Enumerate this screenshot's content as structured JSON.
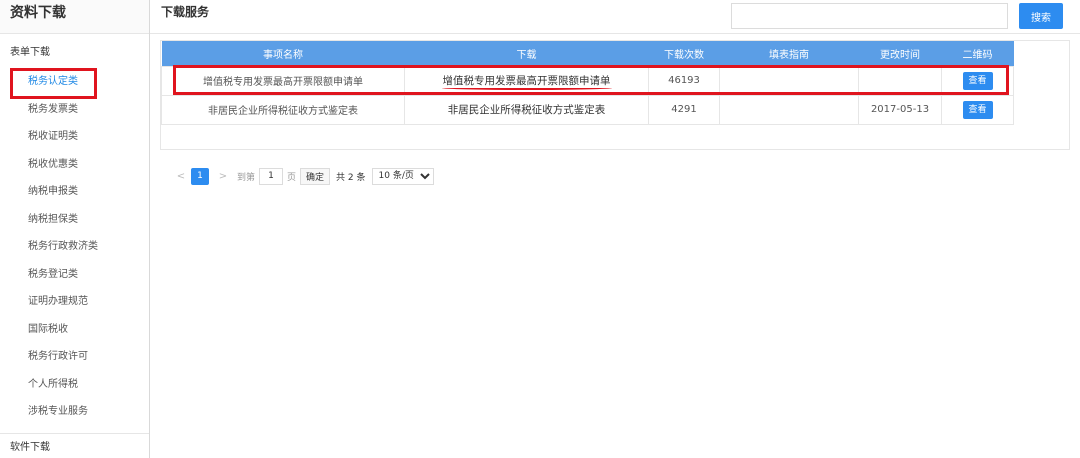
{
  "sidebar": {
    "title": "资料下载",
    "section": "表单下载",
    "items": [
      {
        "label": "税务认定类",
        "active": true
      },
      {
        "label": "税务发票类"
      },
      {
        "label": "税收证明类"
      },
      {
        "label": "税收优惠类"
      },
      {
        "label": "纳税申报类"
      },
      {
        "label": "纳税担保类"
      },
      {
        "label": "税务行政救济类"
      },
      {
        "label": "税务登记类"
      },
      {
        "label": "证明办理规范"
      },
      {
        "label": "国际税收"
      },
      {
        "label": "税务行政许可"
      },
      {
        "label": "个人所得税"
      },
      {
        "label": "涉税专业服务"
      }
    ],
    "bottom": "软件下载"
  },
  "header": {
    "title": "下载服务",
    "search_placeholder": "",
    "search_label": "搜索"
  },
  "table": {
    "columns": [
      "事项名称",
      "下载",
      "下载次数",
      "填表指南",
      "更改时间",
      "二维码"
    ],
    "rows": [
      {
        "name": "增值税专用发票最高开票限额申请单",
        "download": "增值税专用发票最高开票限额申请单",
        "count": "46193",
        "guide": "",
        "time": "",
        "qr": "查看"
      },
      {
        "name": "非居民企业所得税征收方式鉴定表",
        "download": "非居民企业所得税征收方式鉴定表",
        "count": "4291",
        "guide": "",
        "time": "2017-05-13",
        "qr": "查看"
      }
    ]
  },
  "pager": {
    "prev": "<",
    "page": "1",
    "next": ">",
    "goto_label": "到第",
    "goto_value": "1",
    "page_unit": "页",
    "confirm": "确定",
    "total": "共 2 条",
    "page_size": "10 条/页"
  },
  "colors": {
    "accent": "#2d8cf0",
    "table_header": "#5b9ee6",
    "highlight": "#e0141e"
  }
}
